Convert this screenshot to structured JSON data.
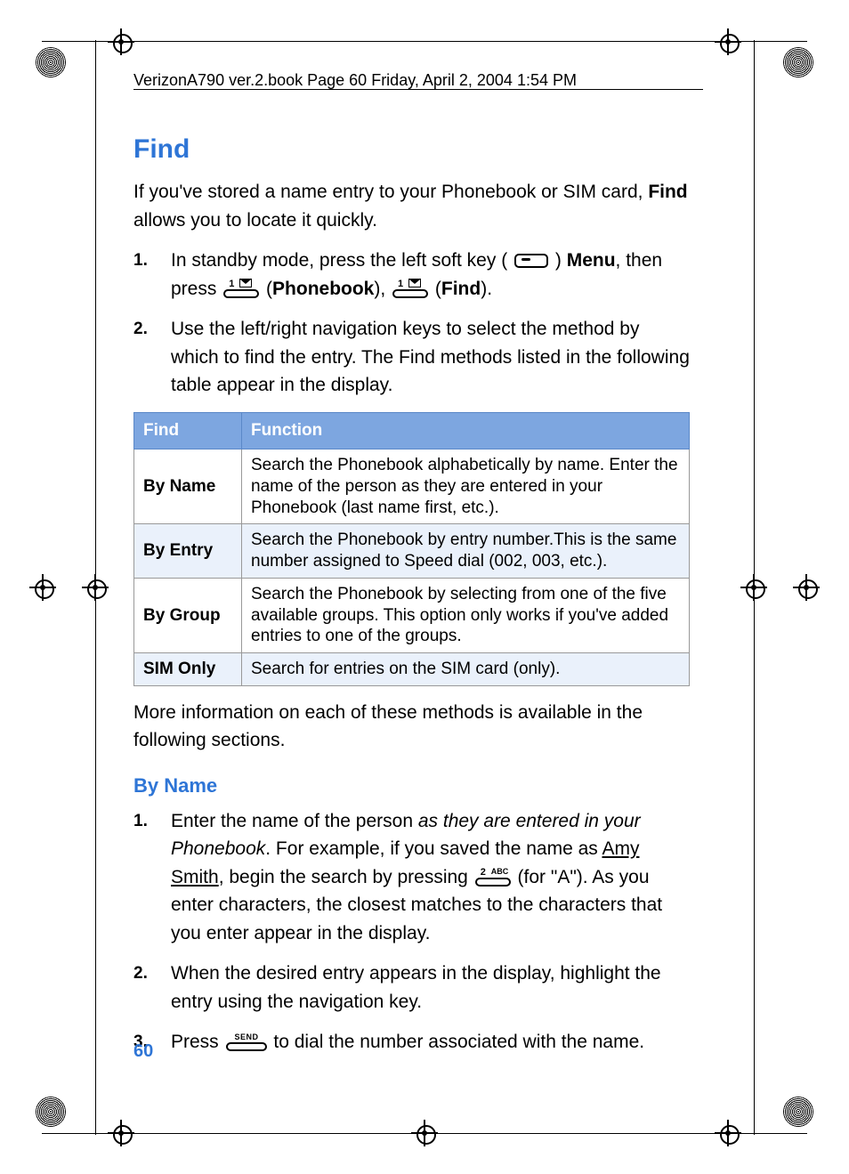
{
  "header": {
    "running_head": "VerizonA790 ver.2.book  Page 60  Friday, April 2, 2004  1:54 PM"
  },
  "section": {
    "title": "Find",
    "intro_prefix": "If you've stored a name entry to your Phonebook or SIM card, ",
    "intro_bold": "Find",
    "intro_suffix": " allows you to locate it quickly."
  },
  "steps_a": {
    "s1_num": "1.",
    "s1_a": "In standby mode, press the left soft key (",
    "s1_b": ") ",
    "s1_menu": "Menu",
    "s1_c": ", then press ",
    "s1_pb": "Phonebook",
    "s1_d": "), ",
    "s1_find": "Find",
    "s1_e": ").",
    "s1_open1": " (",
    "s1_open2": " (",
    "s2_num": "2.",
    "s2": "Use the left/right navigation keys to select the method by which to find the entry. The Find methods listed in the following table appear in the display."
  },
  "table": {
    "h1": "Find",
    "h2": "Function",
    "rows": [
      {
        "label": "By Name",
        "desc": "Search the Phonebook alphabetically by name. Enter the name of the person as they are entered in your Phonebook (last name first, etc.)."
      },
      {
        "label": "By Entry",
        "desc": "Search the Phonebook by entry number.This is the same number assigned to Speed dial (002, 003, etc.)."
      },
      {
        "label": "By Group",
        "desc": "Search the Phonebook by selecting from one of the five available groups. This option only works if you've added entries to one of the groups."
      },
      {
        "label": "SIM Only",
        "desc": "Search for entries on the SIM card (only)."
      }
    ]
  },
  "after_table": "More information on each of these methods is available in the following sections.",
  "subsection": {
    "title": "By Name"
  },
  "steps_b": {
    "s1_num": "1.",
    "s1_a": "Enter the name of the person ",
    "s1_ital": "as they are entered in your Phonebook",
    "s1_b": ". For example, if you saved the name as ",
    "s1_amy": "Amy",
    "s1_space": " ",
    "s1_smith": "Smith",
    "s1_c": ", begin the search by pressing ",
    "s1_d": " (for \"A\"). As you enter characters, the closest matches to the characters that you enter appear in the display.",
    "s2_num": "2.",
    "s2": "When the desired entry appears in the display, highlight the entry using the navigation key.",
    "s3_num": "3.",
    "s3_a": "Press ",
    "s3_b": " to dial the number associated with the name."
  },
  "key_labels": {
    "one": "1",
    "two": "2",
    "abc": "ABC",
    "send": "SEND"
  },
  "page_number": "60"
}
